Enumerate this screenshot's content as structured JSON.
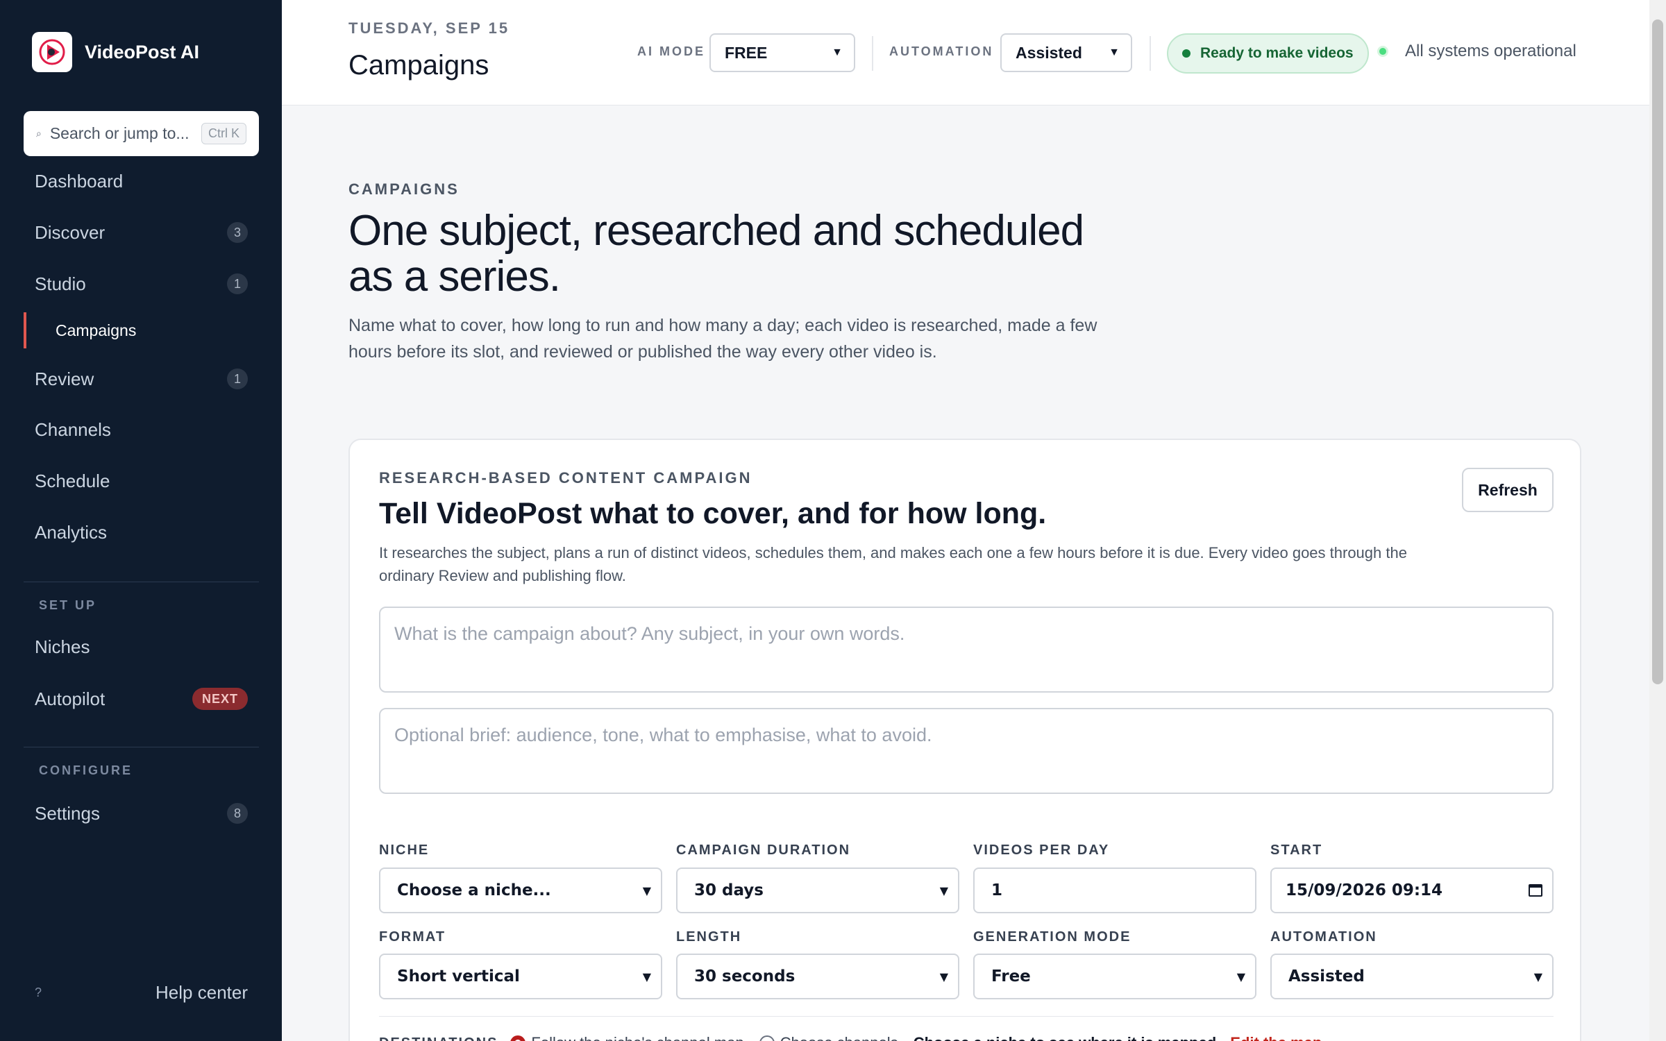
{
  "sidebar": {
    "brand": "VideoPost AI",
    "search": {
      "placeholder": "Search or jump to...",
      "shortcut": "Ctrl K"
    },
    "nav": [
      {
        "label": "Dashboard",
        "badge": ""
      },
      {
        "label": "Discover",
        "badge": "3"
      },
      {
        "label": "Studio",
        "badge": "1"
      },
      {
        "label": "Review",
        "badge": "1"
      },
      {
        "label": "Channels",
        "badge": ""
      },
      {
        "label": "Schedule",
        "badge": ""
      },
      {
        "label": "Analytics",
        "badge": ""
      }
    ],
    "sub_item": "Campaigns",
    "setup": {
      "label": "SET UP",
      "niches": "Niches",
      "autopilot": "Autopilot",
      "autopilot_badge": "NEXT"
    },
    "configure": {
      "label": "CONFIGURE",
      "settings": "Settings",
      "settings_badge": "8"
    },
    "help": {
      "icon": "?",
      "label": "Help center"
    }
  },
  "topbar": {
    "date": "TUESDAY, SEP 15",
    "title": "Campaigns",
    "ai_mode_label": "AI MODE",
    "ai_mode_value": "FREE",
    "automation_label": "AUTOMATION",
    "automation_value": "Assisted",
    "status_pill": "Ready to make videos",
    "system_status": "All systems operational"
  },
  "hero": {
    "eyebrow": "CAMPAIGNS",
    "title": "One subject, researched and scheduled as a series.",
    "description": "Name what to cover, how long to run and how many a day; each video is researched, made a few hours before its slot, and reviewed or published the way every other video is."
  },
  "card": {
    "eyebrow": "RESEARCH-BASED CONTENT CAMPAIGN",
    "title": "Tell VideoPost what to cover, and for how long.",
    "description": "It researches the subject, plans a run of distinct videos, schedules them, and makes each one a few hours before it is due. Every video goes through the ordinary Review and publishing flow.",
    "refresh": "Refresh",
    "subject_placeholder": "What is the campaign about? Any subject, in your own words.",
    "brief_placeholder": "Optional brief: audience, tone, what to emphasise, what to avoid.",
    "fields": {
      "niche_label": "NICHE",
      "niche_value": "Choose a niche...",
      "duration_label": "CAMPAIGN DURATION",
      "duration_value": "30 days",
      "vpd_label": "VIDEOS PER DAY",
      "vpd_value": "1",
      "start_label": "START",
      "start_value": "15/09/2026 09:14",
      "format_label": "FORMAT",
      "format_value": "Short vertical",
      "length_label": "LENGTH",
      "length_value": "30 seconds",
      "gen_label": "GENERATION MODE",
      "gen_value": "Free",
      "auto_label": "AUTOMATION",
      "auto_value": "Assisted"
    },
    "destinations": {
      "label": "DESTINATIONS",
      "opt_follow": "Follow the niche's channel map",
      "opt_choose": "Choose channels",
      "hint": "Choose a niche to see where it is mapped.",
      "link": "Edit the map"
    }
  },
  "colors": {
    "sidebar_bg": "#0f1c2e",
    "accent": "#e0574f",
    "success": "#15803d",
    "link": "#c2261d"
  }
}
